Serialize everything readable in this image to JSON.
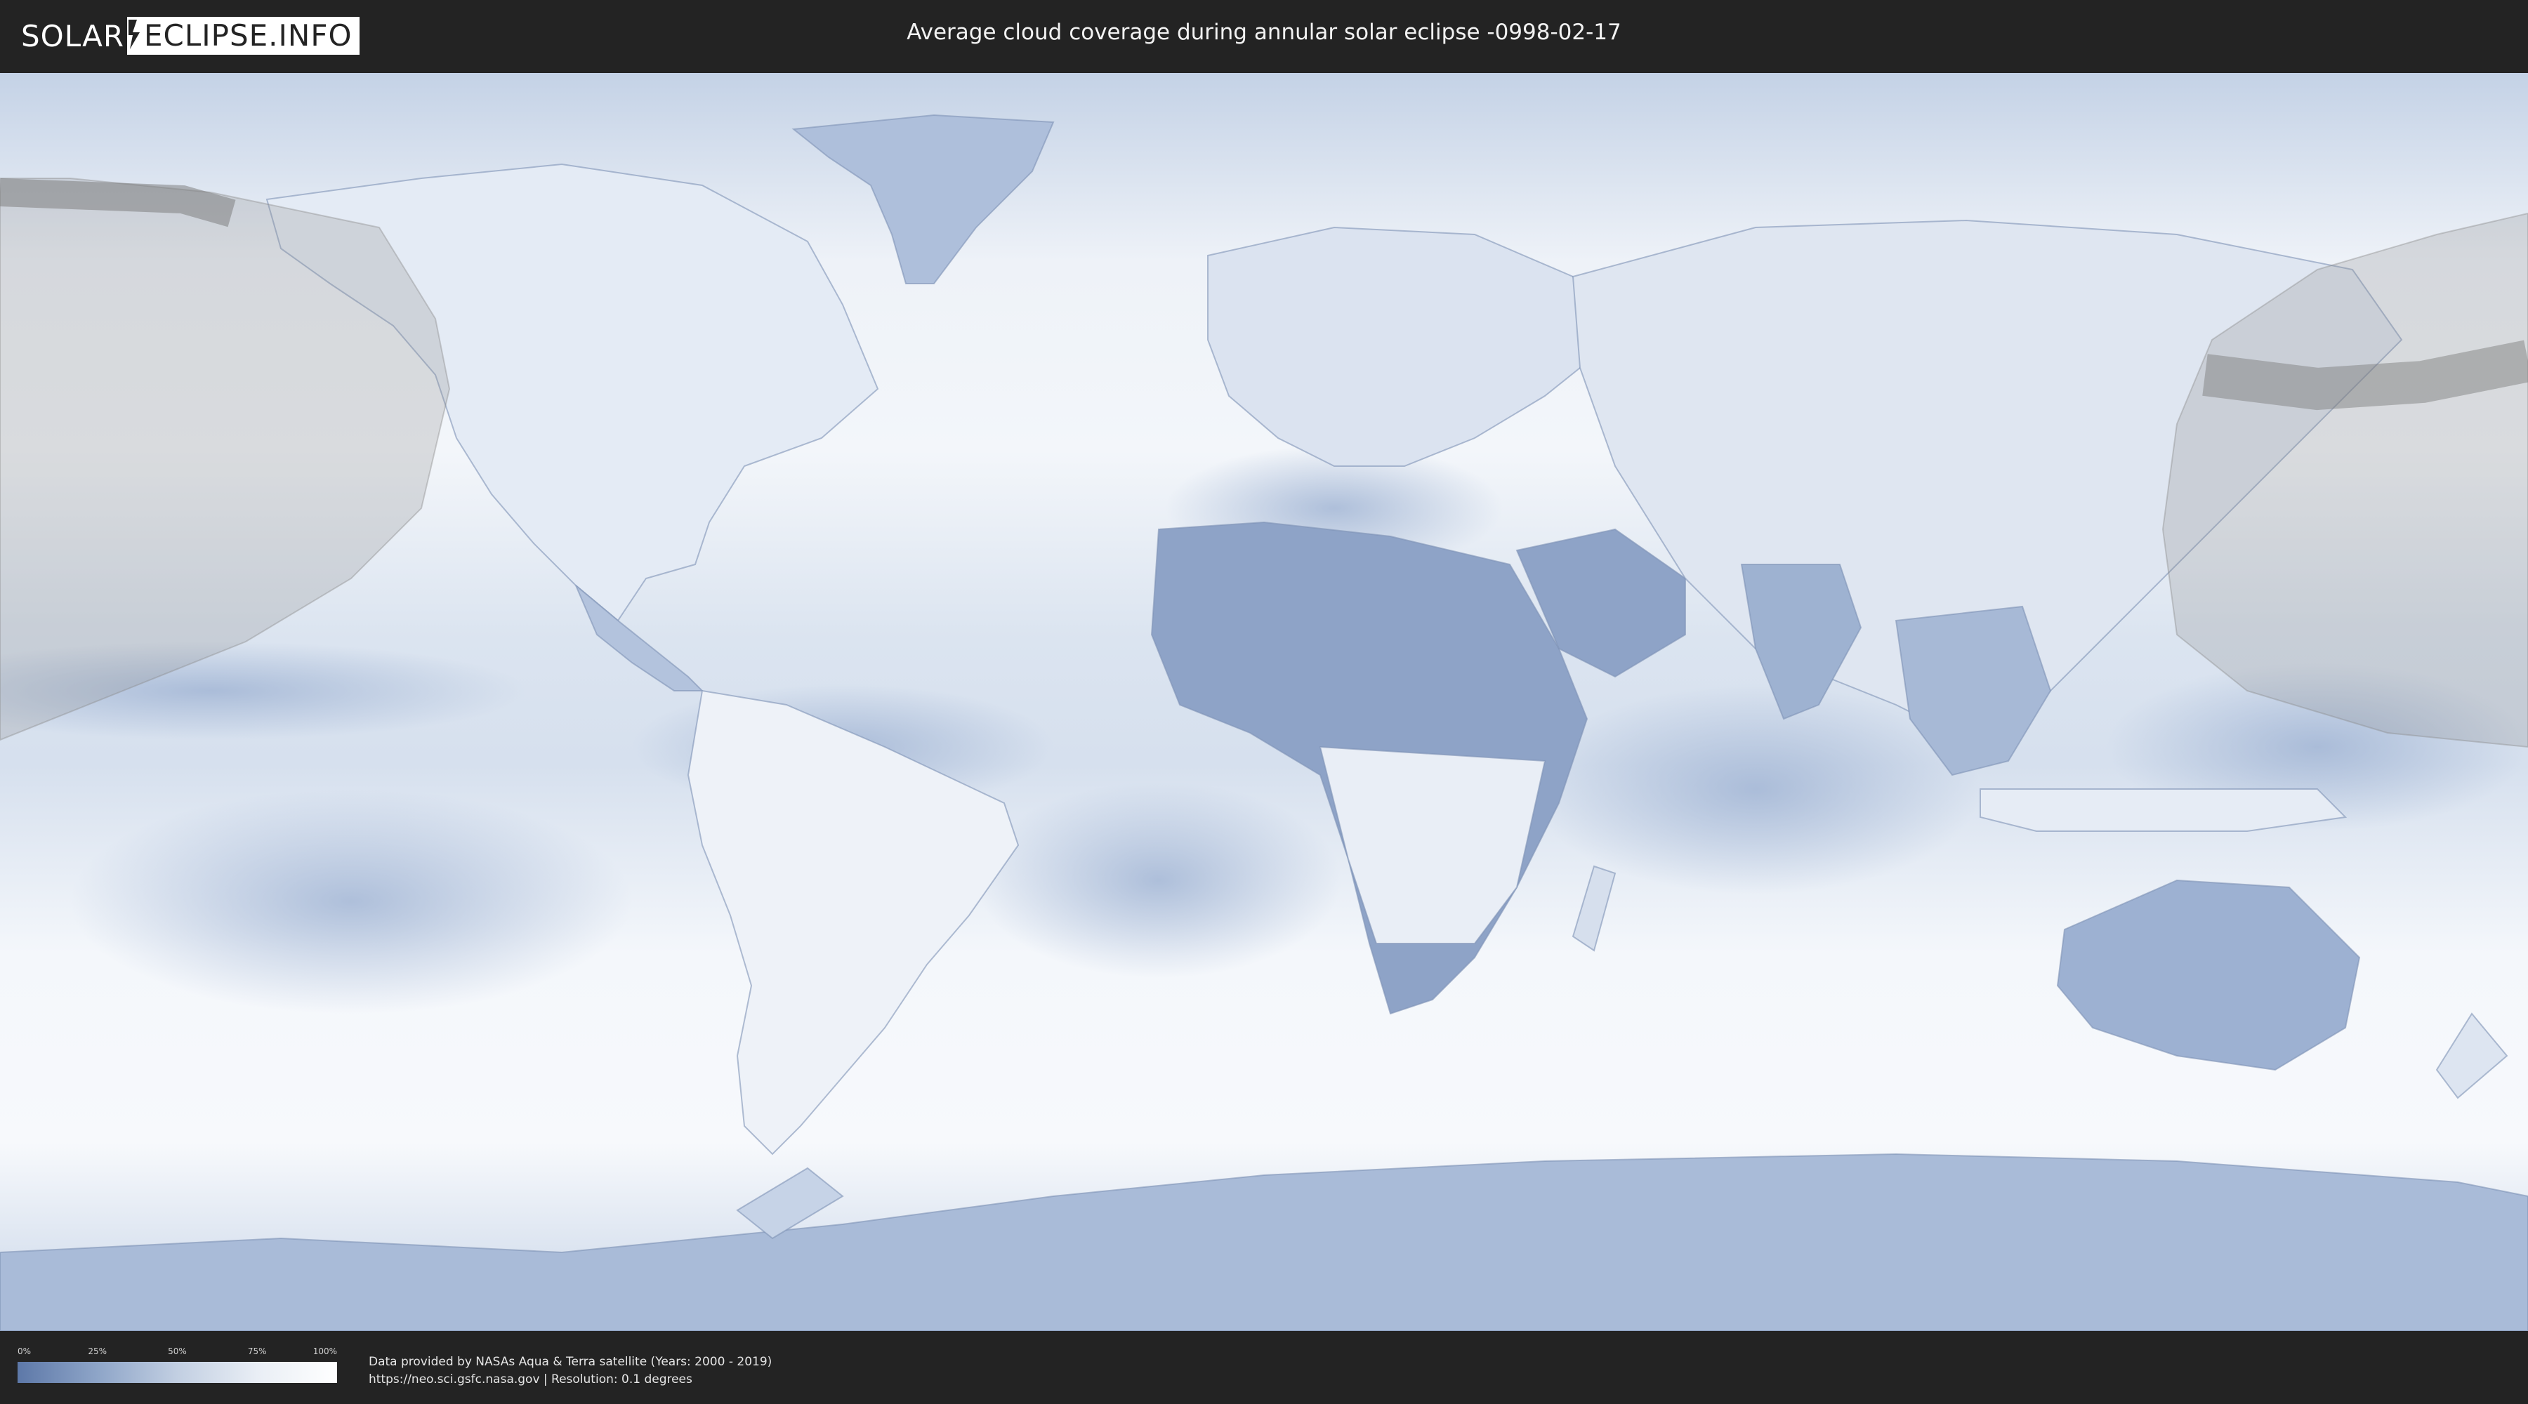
{
  "header": {
    "logo_left": "SOLAR",
    "logo_right": "ECLIPSE.INFO",
    "title": "Average cloud coverage during annular solar eclipse -0998-02-17"
  },
  "legend": {
    "ticks": [
      "0%",
      "25%",
      "50%",
      "75%",
      "100%"
    ],
    "colors": [
      "#5d78a8",
      "#8ea5c8",
      "#c2cfe2",
      "#e9eef5",
      "#ffffff"
    ]
  },
  "credits": {
    "line1": "Data provided by NASAs Aqua & Terra satellite (Years: 2000 - 2019)",
    "line2": "https://neo.sci.gsfc.nasa.gov | Resolution: 0.1 degrees"
  },
  "map": {
    "projection": "equirectangular",
    "ocean_color": "#dfe7f2",
    "land_tint": "#8fa5c9",
    "eclipse_shadow_color": "#8a8a8a",
    "icons": [
      "bolt-icon"
    ]
  }
}
